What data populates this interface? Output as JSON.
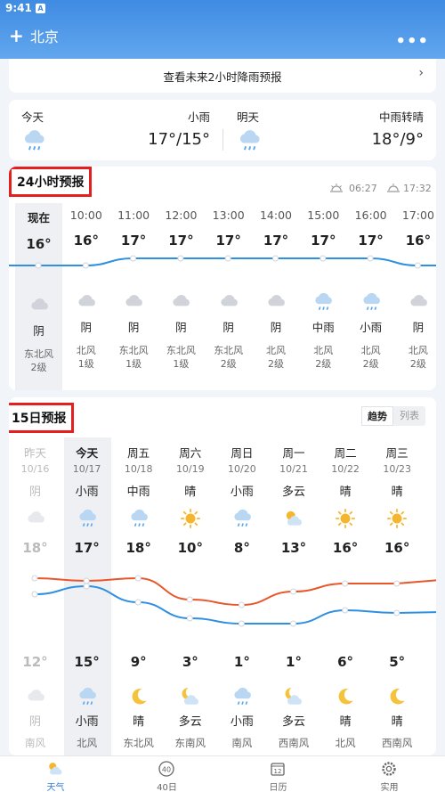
{
  "status_bar": {
    "time": "9:41",
    "notif": "A"
  },
  "header": {
    "add": "+",
    "city": "北京",
    "more": "•••"
  },
  "rain_banner": {
    "text": "查看未来2小时降雨预报",
    "arrow": "›"
  },
  "today": {
    "name": "今天",
    "desc": "小雨",
    "temp": "17°/15°",
    "icon": "rain-cloud-icon"
  },
  "tomorrow": {
    "name": "明天",
    "desc": "中雨转晴",
    "temp": "18°/9°",
    "icon": "rain-cloud-icon"
  },
  "hourly": {
    "title": "24小时预报",
    "sunrise": "06:27",
    "sunset": "17:32",
    "hours": [
      {
        "time": "现在",
        "temp": "16°",
        "temp_value": 16,
        "icon": "cloud-icon",
        "desc": "阴",
        "wind": "东北风",
        "level": "2级"
      },
      {
        "time": "10:00",
        "temp": "16°",
        "temp_value": 16,
        "icon": "cloud-icon",
        "desc": "阴",
        "wind": "北风",
        "level": "1级"
      },
      {
        "time": "11:00",
        "temp": "17°",
        "temp_value": 17,
        "icon": "cloud-icon",
        "desc": "阴",
        "wind": "东北风",
        "level": "1级"
      },
      {
        "time": "12:00",
        "temp": "17°",
        "temp_value": 17,
        "icon": "cloud-icon",
        "desc": "阴",
        "wind": "东北风",
        "level": "1级"
      },
      {
        "time": "13:00",
        "temp": "17°",
        "temp_value": 17,
        "icon": "cloud-icon",
        "desc": "阴",
        "wind": "东北风",
        "level": "2级"
      },
      {
        "time": "14:00",
        "temp": "17°",
        "temp_value": 17,
        "icon": "cloud-icon",
        "desc": "阴",
        "wind": "北风",
        "level": "2级"
      },
      {
        "time": "15:00",
        "temp": "17°",
        "temp_value": 17,
        "icon": "rain-cloud-icon",
        "desc": "中雨",
        "wind": "北风",
        "level": "2级"
      },
      {
        "time": "16:00",
        "temp": "17°",
        "temp_value": 17,
        "icon": "rain-cloud-icon",
        "desc": "小雨",
        "wind": "北风",
        "level": "2级"
      },
      {
        "time": "17:00",
        "temp": "16°",
        "temp_value": 16,
        "icon": "cloud-icon",
        "desc": "阴",
        "wind": "北风",
        "level": "2级"
      }
    ]
  },
  "daily": {
    "title": "15日预报",
    "toggle_trend": "趋势",
    "toggle_list": "列表",
    "days": [
      {
        "name": "昨天",
        "date": "10/16",
        "desc_day": "阴",
        "icon_day": "cloud-icon",
        "high": "18°",
        "high_value": 18,
        "low": "12°",
        "low_value": 12,
        "icon_night": "cloud-icon",
        "desc_night": "阴",
        "wind": "南风",
        "past": true
      },
      {
        "name": "今天",
        "date": "10/17",
        "desc_day": "小雨",
        "icon_day": "rain-cloud-icon",
        "high": "17°",
        "high_value": 17,
        "low": "15°",
        "low_value": 15,
        "icon_night": "rain-cloud-icon",
        "desc_night": "小雨",
        "wind": "北风",
        "past": false
      },
      {
        "name": "周五",
        "date": "10/18",
        "desc_day": "中雨",
        "icon_day": "rain-cloud-icon",
        "high": "18°",
        "high_value": 18,
        "low": "9°",
        "low_value": 9,
        "icon_night": "moon-icon",
        "desc_night": "晴",
        "wind": "东北风",
        "past": false
      },
      {
        "name": "周六",
        "date": "10/19",
        "desc_day": "晴",
        "icon_day": "sun-icon",
        "high": "10°",
        "high_value": 10,
        "low": "3°",
        "low_value": 3,
        "icon_night": "moon-cloud-icon",
        "desc_night": "多云",
        "wind": "东南风",
        "past": false
      },
      {
        "name": "周日",
        "date": "10/20",
        "desc_day": "小雨",
        "icon_day": "rain-cloud-icon",
        "high": "8°",
        "high_value": 8,
        "low": "1°",
        "low_value": 1,
        "icon_night": "rain-cloud-icon",
        "desc_night": "小雨",
        "wind": "南风",
        "past": false
      },
      {
        "name": "周一",
        "date": "10/21",
        "desc_day": "多云",
        "icon_day": "sun-cloud-icon",
        "high": "13°",
        "high_value": 13,
        "low": "1°",
        "low_value": 1,
        "icon_night": "moon-cloud-icon",
        "desc_night": "多云",
        "wind": "西南风",
        "past": false
      },
      {
        "name": "周二",
        "date": "10/22",
        "desc_day": "晴",
        "icon_day": "sun-icon",
        "high": "16°",
        "high_value": 16,
        "low": "6°",
        "low_value": 6,
        "icon_night": "moon-icon",
        "desc_night": "晴",
        "wind": "北风",
        "past": false
      },
      {
        "name": "周三",
        "date": "10/23",
        "desc_day": "晴",
        "icon_day": "sun-icon",
        "high": "16°",
        "high_value": 16,
        "low": "5°",
        "low_value": 5,
        "icon_night": "moon-icon",
        "desc_night": "晴",
        "wind": "西南风",
        "past": false
      }
    ]
  },
  "nav": [
    {
      "label": "天气",
      "icon": "weather-icon",
      "active": true
    },
    {
      "label": "40日",
      "icon": "forty-day-icon",
      "badge": "40",
      "active": false
    },
    {
      "label": "日历",
      "icon": "calendar-icon",
      "badge": "12",
      "active": false
    },
    {
      "label": "实用",
      "icon": "gear-icon",
      "active": false
    }
  ],
  "colors": {
    "header": "#4b93e6",
    "high_line": "#e8562a",
    "low_line": "#2f8fe0",
    "highlight_box": "#e31f1f",
    "active_nav": "#2f7fdc"
  }
}
